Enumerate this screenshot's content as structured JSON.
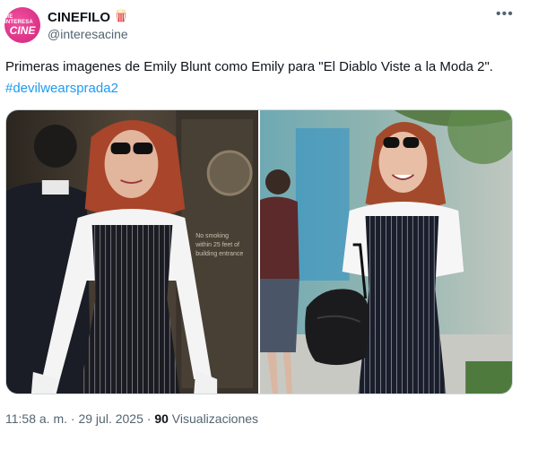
{
  "author": {
    "name": "CINEFILO",
    "handle": "@interesacine",
    "avatar_line1": "ME INTERESA",
    "avatar_line2": "CINE",
    "badge_icon": "popcorn-icon"
  },
  "tweet": {
    "text": "Primeras imagenes de Emily Blunt como Emily para \"El Diablo Viste a la Moda 2\".",
    "hashtag": "#devilwearsprada2"
  },
  "media": {
    "sign_text": "No smoking within 25 feet of building entrance"
  },
  "meta": {
    "time": "11:58 a. m.",
    "date": "29 jul. 2025",
    "views_count": "90",
    "views_label": "Visualizaciones"
  },
  "colors": {
    "brand_pink": "#e0338d",
    "link": "#1d9bf0",
    "secondary_text": "#536471"
  }
}
